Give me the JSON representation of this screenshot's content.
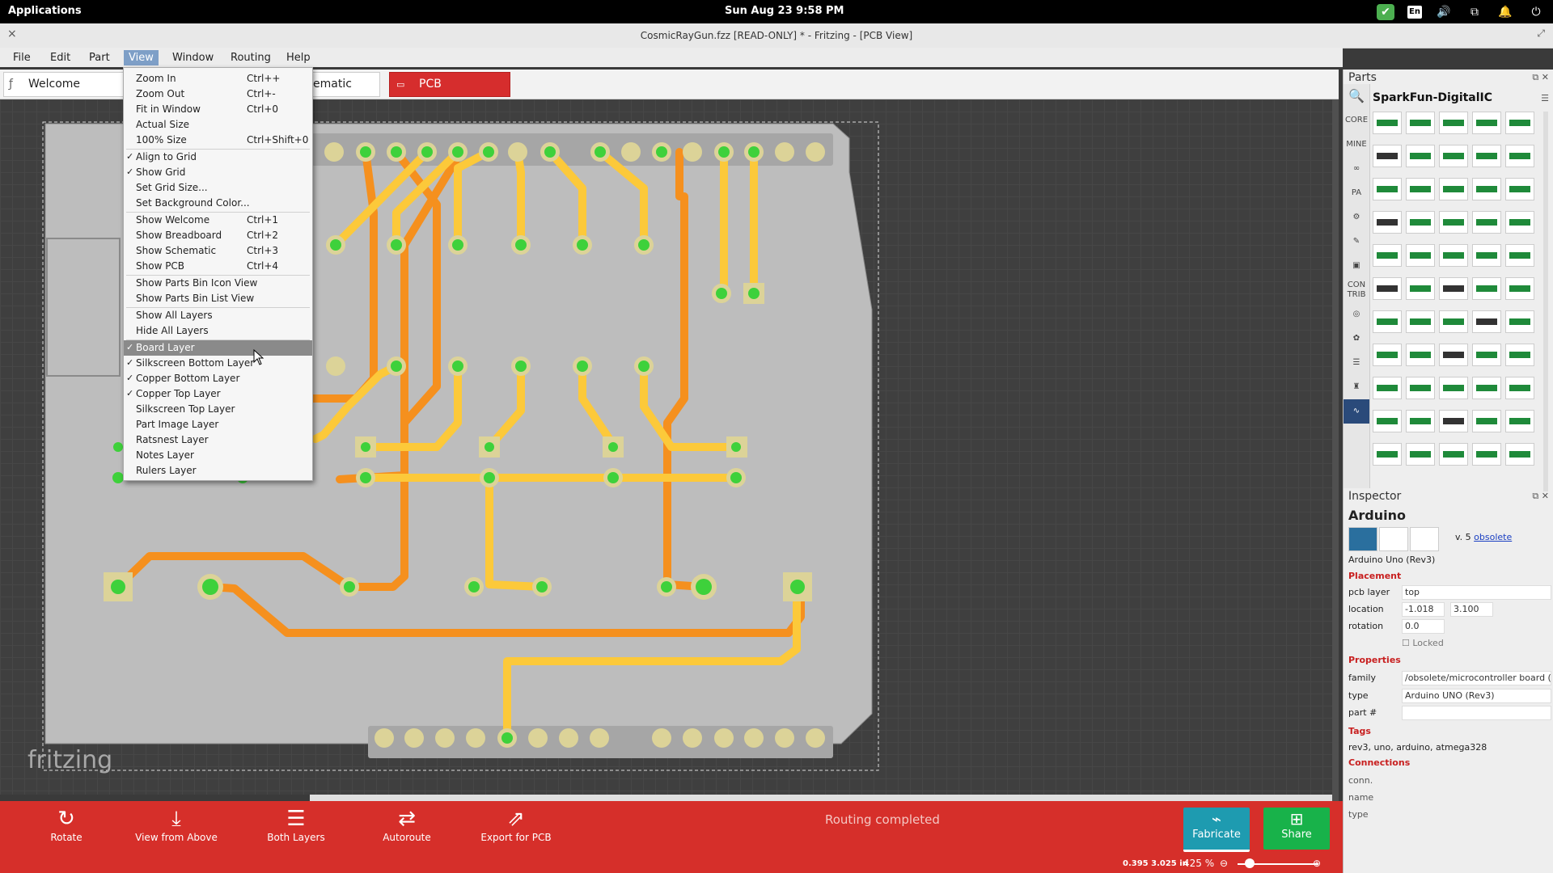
{
  "topbar": {
    "applications": "Applications",
    "clock": "Sun Aug 23    9:58 PM",
    "lang": "En"
  },
  "window": {
    "title": "CosmicRayGun.fzz [READ-ONLY] * - Fritzing - [PCB View]",
    "close": "×",
    "maximize": "⤢"
  },
  "menubar": {
    "items": [
      "File",
      "Edit",
      "Part",
      "View",
      "Window",
      "Routing",
      "Help"
    ],
    "active": "View"
  },
  "tabs": {
    "welcome": "Welcome",
    "schematic": "ematic",
    "pcb": "PCB"
  },
  "view_menu": {
    "items": [
      {
        "label": "Zoom In",
        "shortcut": "Ctrl++",
        "checked": false
      },
      {
        "label": "Zoom Out",
        "shortcut": "Ctrl+-",
        "checked": false
      },
      {
        "label": "Fit in Window",
        "shortcut": "Ctrl+0",
        "checked": false
      },
      {
        "label": "Actual Size",
        "shortcut": "",
        "checked": false
      },
      {
        "label": "100% Size",
        "shortcut": "Ctrl+Shift+0",
        "checked": false
      },
      {
        "label": "Align to Grid",
        "shortcut": "",
        "checked": true
      },
      {
        "label": "Show Grid",
        "shortcut": "",
        "checked": true
      },
      {
        "label": "Set Grid Size...",
        "shortcut": "",
        "checked": false
      },
      {
        "label": "Set Background Color...",
        "shortcut": "",
        "checked": false
      },
      {
        "label": "Show Welcome",
        "shortcut": "Ctrl+1",
        "checked": false
      },
      {
        "label": "Show Breadboard",
        "shortcut": "Ctrl+2",
        "checked": false
      },
      {
        "label": "Show Schematic",
        "shortcut": "Ctrl+3",
        "checked": false
      },
      {
        "label": "Show PCB",
        "shortcut": "Ctrl+4",
        "checked": false
      },
      {
        "label": "Show Parts Bin Icon View",
        "shortcut": "",
        "checked": false
      },
      {
        "label": "Show Parts Bin List View",
        "shortcut": "",
        "checked": false
      },
      {
        "label": "Show All Layers",
        "shortcut": "",
        "checked": false
      },
      {
        "label": "Hide All Layers",
        "shortcut": "",
        "checked": false
      },
      {
        "label": "Board Layer",
        "shortcut": "",
        "checked": true,
        "highlighted": true
      },
      {
        "label": "Silkscreen Bottom Layer",
        "shortcut": "",
        "checked": true
      },
      {
        "label": "Copper Bottom Layer",
        "shortcut": "",
        "checked": true
      },
      {
        "label": "Copper Top Layer",
        "shortcut": "",
        "checked": true
      },
      {
        "label": "Silkscreen Top Layer",
        "shortcut": "",
        "checked": false
      },
      {
        "label": "Part Image Layer",
        "shortcut": "",
        "checked": false
      },
      {
        "label": "Ratsnest Layer",
        "shortcut": "",
        "checked": false
      },
      {
        "label": "Notes Layer",
        "shortcut": "",
        "checked": false
      },
      {
        "label": "Rulers Layer",
        "shortcut": "",
        "checked": false
      }
    ]
  },
  "canvas": {
    "watermark": "fritzing"
  },
  "toolbar": {
    "rotate": "Rotate",
    "view_from_above": "View from Above",
    "both_layers": "Both Layers",
    "autoroute": "Autoroute",
    "export": "Export for PCB",
    "routing_status": "Routing completed",
    "fabricate": "Fabricate",
    "share": "Share"
  },
  "statusbar": {
    "coords": "0.395 3.025 in",
    "zoom": "425",
    "zoom_unit": "%"
  },
  "parts": {
    "title": "Parts",
    "bin_title": "SparkFun-DigitalIC",
    "sidebar": [
      "CORE",
      "MINE",
      "∞",
      "PA",
      "⚙",
      "✎",
      "▣",
      "CON TRIB",
      "◎",
      "✿",
      "☰",
      "♜",
      "∿"
    ]
  },
  "inspector": {
    "title": "Inspector",
    "part_name": "Arduino",
    "version": "v. 5",
    "obsolete_link": "obsolete",
    "subtitle": "Arduino Uno (Rev3)",
    "placement_header": "Placement",
    "pcb_layer_label": "pcb layer",
    "pcb_layer_value": "top",
    "location_label": "location",
    "location_x": "-1.018",
    "location_y": "3.100",
    "rotation_label": "rotation",
    "rotation_value": "0.0",
    "locked_label": "Locked",
    "properties_header": "Properties",
    "family_label": "family",
    "family_value": "/obsolete/microcontroller board (arc",
    "type_label": "type",
    "type_value": "Arduino UNO (Rev3)",
    "part_num_label": "part #",
    "tags_header": "Tags",
    "tags_value": "rev3, uno, arduino, atmega328",
    "connections_header": "Connections",
    "conn_label": "conn.",
    "name_label": "name",
    "ctype_label": "type"
  },
  "colors": {
    "accent_red": "#d62f2a",
    "trace_orange": "#f5901e",
    "trace_yellow": "#fcc93a",
    "pad_green": "#3ed13b",
    "fabricate": "#1e9bb0",
    "share": "#18b24a"
  }
}
